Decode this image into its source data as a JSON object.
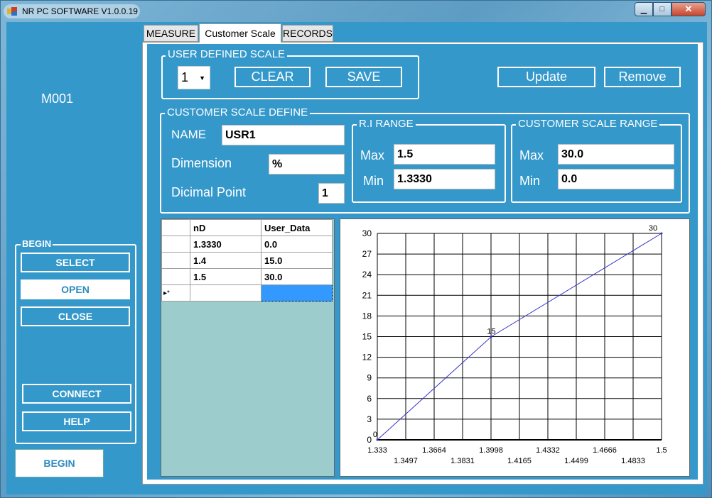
{
  "window": {
    "title": "NR PC SOFTWARE V1.0.0.19",
    "controls": {
      "minimize": "▁",
      "maximize": "□",
      "close": "✕"
    }
  },
  "left_panel": {
    "device_id": "M001",
    "group_title": "BEGIN",
    "buttons": {
      "select": "SELECT",
      "open": "OPEN",
      "close": "CLOSE",
      "connect": "CONNECT",
      "help": "HELP"
    },
    "begin_button": "BEGIN"
  },
  "tabs": [
    {
      "label": "MEASURE",
      "active": false
    },
    {
      "label": "Customer Scale",
      "active": true
    },
    {
      "label": "RECORDS",
      "active": false
    }
  ],
  "user_defined_scale": {
    "title": "USER DEFINED SCALE",
    "selected_scale": "1",
    "clear_label": "CLEAR",
    "save_label": "SAVE",
    "update_label": "Update",
    "remove_label": "Remove"
  },
  "customer_scale_define": {
    "title": "CUSTOMER SCALE DEFINE",
    "name_label": "NAME",
    "name_value": "USR1",
    "dimension_label": "Dimension",
    "dimension_value": "%",
    "decimal_label": "Dicimal Point",
    "decimal_value": "1",
    "ri_range": {
      "title": "R.I RANGE",
      "max_label": "Max",
      "max_value": "1.5",
      "min_label": "Min",
      "min_value": "1.3330"
    },
    "customer_range": {
      "title": "CUSTOMER SCALE RANGE",
      "max_label": "Max",
      "max_value": "30.0",
      "min_label": "Min",
      "min_value": "0.0"
    }
  },
  "grid": {
    "columns": [
      "nD",
      "User_Data"
    ],
    "rows": [
      [
        "1.3330",
        "0.0"
      ],
      [
        "1.4",
        "15.0"
      ],
      [
        "1.5",
        "30.0"
      ]
    ],
    "new_row_marker": "▸*"
  },
  "chart_data": {
    "type": "line",
    "x": [
      1.333,
      1.4,
      1.5
    ],
    "y": [
      0,
      15,
      30
    ],
    "point_labels": [
      "0",
      "15",
      "30"
    ],
    "xlim": [
      1.333,
      1.5
    ],
    "ylim": [
      0,
      30
    ],
    "x_ticks_top": [
      "1.333",
      "1.3664",
      "1.3998",
      "1.4332",
      "1.4666",
      "1.5"
    ],
    "x_ticks_bottom": [
      "1.3497",
      "1.3831",
      "1.4165",
      "1.4499",
      "1.4833"
    ],
    "y_ticks": [
      "0",
      "3",
      "6",
      "9",
      "12",
      "15",
      "18",
      "21",
      "24",
      "27",
      "30"
    ],
    "grid": true,
    "line_color": "#3333cc"
  }
}
